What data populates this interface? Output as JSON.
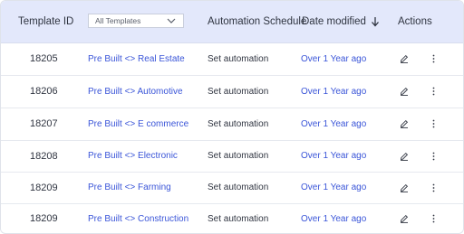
{
  "header": {
    "template_id": "Template ID",
    "filter_value": "All Templates",
    "automation_schedule": "Automation Schedule",
    "date_modified": "Date modified",
    "actions": "Actions"
  },
  "icons": {
    "filter_dropdown": "chevron-down-icon",
    "sort": "arrow-down-icon",
    "edit": "pencil-icon",
    "more": "more-vertical-icon"
  },
  "colors": {
    "header_bg": "#e3e8fb",
    "link": "#3a55d8",
    "text": "#2f3440"
  },
  "rows": [
    {
      "id": "18205",
      "name": "Pre Built <> Real Estate",
      "automation": "Set automation",
      "modified": "Over 1 Year ago"
    },
    {
      "id": "18206",
      "name": "Pre Built <> Automotive",
      "automation": "Set automation",
      "modified": "Over 1 Year ago"
    },
    {
      "id": "18207",
      "name": "Pre Built <> E commerce",
      "automation": "Set automation",
      "modified": "Over 1 Year ago"
    },
    {
      "id": "18208",
      "name": "Pre Built <> Electronic",
      "automation": "Set automation",
      "modified": "Over 1 Year ago"
    },
    {
      "id": "18209",
      "name": "Pre Built <> Farming",
      "automation": "Set automation",
      "modified": "Over 1 Year ago"
    },
    {
      "id": "18209",
      "name": "Pre Built <> Construction",
      "automation": "Set automation",
      "modified": "Over 1 Year ago"
    }
  ]
}
